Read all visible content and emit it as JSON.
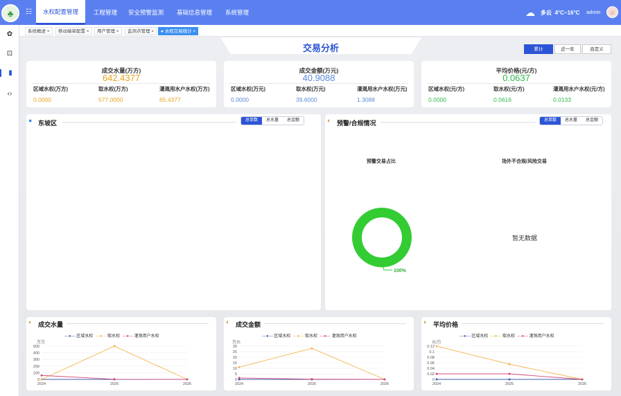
{
  "nav": {
    "logo_glyph": "♣",
    "menu": [
      "水权配置管理",
      "工程管理",
      "安全预警监测",
      "基础信息管理",
      "系统管理"
    ],
    "weather": "多云",
    "temp": "4°C~16°C",
    "user": "admin"
  },
  "tabs": [
    "系统概述 ×",
    "移动端单配置 ×",
    "用户管理 ×",
    "监测点管理 ×",
    "● 水权交易统计 ×"
  ],
  "page": {
    "title": "交易分析",
    "periods": [
      "累计",
      "近一年",
      "自定义"
    ]
  },
  "stats": [
    {
      "title": "成交水量(万方)",
      "value": "642.4377",
      "color": "#e8a21b",
      "items": [
        {
          "label": "区域水权(万方)",
          "value": "0.0000"
        },
        {
          "label": "取水权(万方)",
          "value": "577.0000"
        },
        {
          "label": "灌溉用水户水权(万方)",
          "value": "65.4377"
        }
      ]
    },
    {
      "title": "成交金额(万元)",
      "value": "40.9088",
      "color": "#5a8ad6",
      "items": [
        {
          "label": "区域水权(万元)",
          "value": "0.0000"
        },
        {
          "label": "取水权(万元)",
          "value": "39.6000"
        },
        {
          "label": "灌溉用水户水权(万元)",
          "value": "1.3088"
        }
      ]
    },
    {
      "title": "平均价格(元/方)",
      "value": "0.0637",
      "color": "#2db84a",
      "items": [
        {
          "label": "区域水权(元/方)",
          "value": "0.0000"
        },
        {
          "label": "取水权(元/方)",
          "value": "0.0616"
        },
        {
          "label": "灌溉用水户水权(元/方)",
          "value": "0.0133"
        }
      ]
    }
  ],
  "district": {
    "title": "东坡区",
    "toggles": [
      "总单数",
      "总水量",
      "总金额"
    ]
  },
  "warning": {
    "title": "预警/合规情况",
    "toggles": [
      "总单数",
      "总水量",
      "总金额"
    ],
    "chart1_title": "预警交易占比",
    "chart1_label": "100%",
    "chart1_percent": 100,
    "chart2_title": "场外不合规/风险交易",
    "no_data": "暂无数据"
  },
  "series_names": [
    "区域水权",
    "取水权",
    "灌溉用户水权"
  ],
  "series_colors": [
    "#3b5ea8",
    "#f2b54e",
    "#d5487a"
  ],
  "chart_data": [
    {
      "type": "line",
      "title": "成交水量",
      "unit": "万方",
      "x": [
        "2024",
        "2025",
        "2026"
      ],
      "ylim": [
        0,
        500
      ],
      "yticks": [
        0,
        100,
        200,
        300,
        400,
        500
      ],
      "series": [
        {
          "name": "区域水权",
          "values": [
            0,
            0,
            0
          ]
        },
        {
          "name": "取水权",
          "values": [
            0,
            500,
            0
          ]
        },
        {
          "name": "灌溉用户水权",
          "values": [
            60,
            2,
            0
          ]
        }
      ]
    },
    {
      "type": "line",
      "title": "成交金额",
      "unit": "万元",
      "x": [
        "2024",
        "2025",
        "2026"
      ],
      "ylim": [
        0,
        30
      ],
      "yticks": [
        0,
        5,
        10,
        15,
        20,
        25,
        30
      ],
      "series": [
        {
          "name": "区域水权",
          "values": [
            0,
            0,
            0
          ]
        },
        {
          "name": "取水权",
          "values": [
            11,
            28,
            0
          ]
        },
        {
          "name": "灌溉用户水权",
          "values": [
            1.3,
            0.2,
            0
          ]
        }
      ]
    },
    {
      "type": "line",
      "title": "平均价格",
      "unit": "元/方",
      "x": [
        "2024",
        "2025",
        "2026"
      ],
      "ylim": [
        0,
        0.12
      ],
      "yticks": [
        0,
        0.02,
        0.04,
        0.06,
        0.08,
        0.1,
        0.12
      ],
      "series": [
        {
          "name": "区域水权",
          "values": [
            0,
            0,
            0
          ]
        },
        {
          "name": "取水权",
          "values": [
            0.12,
            0.055,
            0
          ]
        },
        {
          "name": "灌溉用户水权",
          "values": [
            0.02,
            0.02,
            0
          ]
        }
      ]
    }
  ]
}
